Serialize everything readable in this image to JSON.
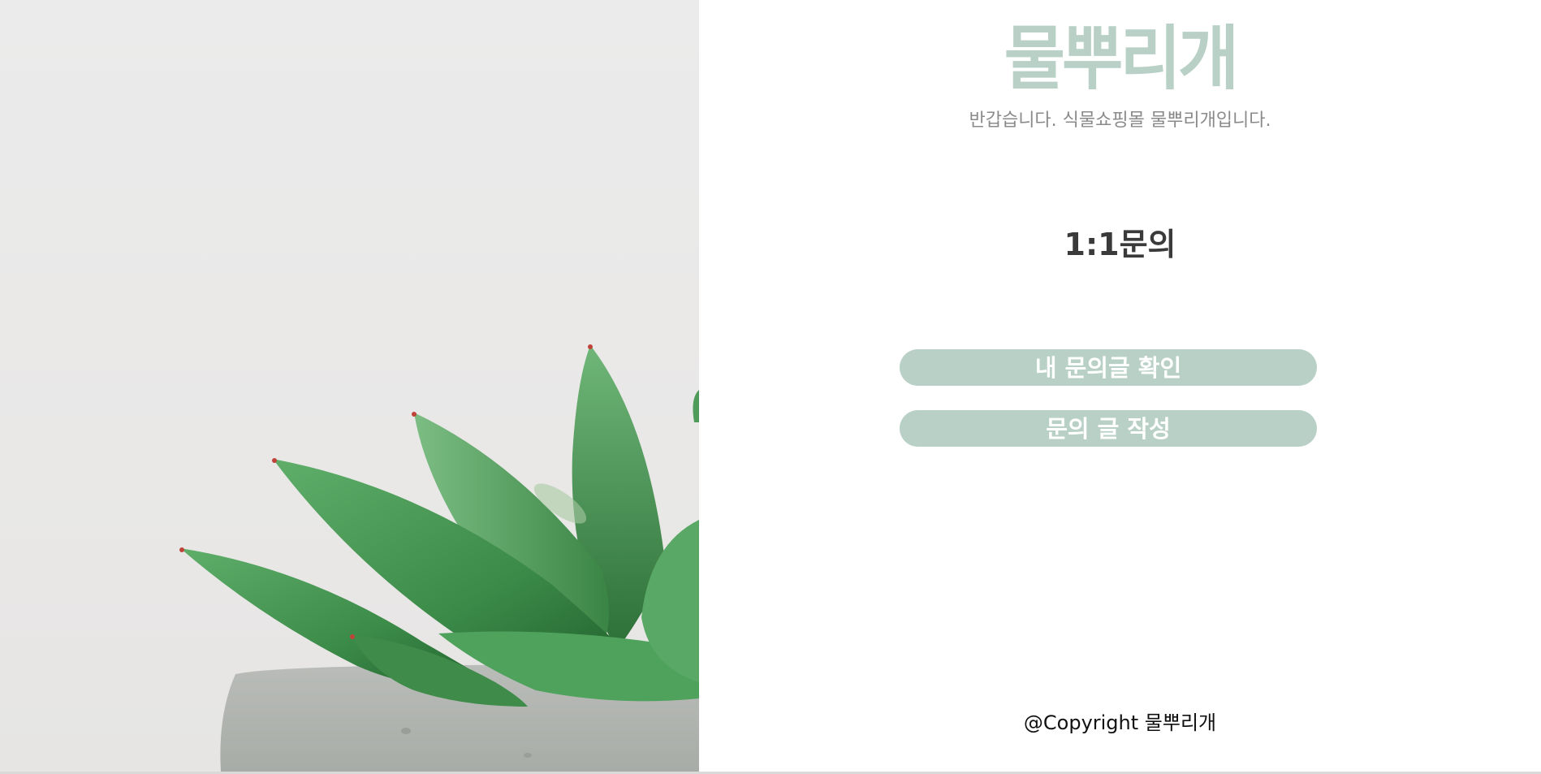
{
  "brand": {
    "logo_text": "물뿌리개",
    "tagline": "반갑습니다. 식물쇼핑몰 물뿌리개입니다.",
    "accent_color": "#b8d0c6"
  },
  "main": {
    "title": "1:1문의",
    "buttons": [
      {
        "label": "내 문의글 확인"
      },
      {
        "label": "문의 글 작성"
      }
    ]
  },
  "footer": {
    "copyright": "@Copyright 물뿌리개"
  },
  "hero_image": {
    "subject": "succulent-plant-photo"
  }
}
